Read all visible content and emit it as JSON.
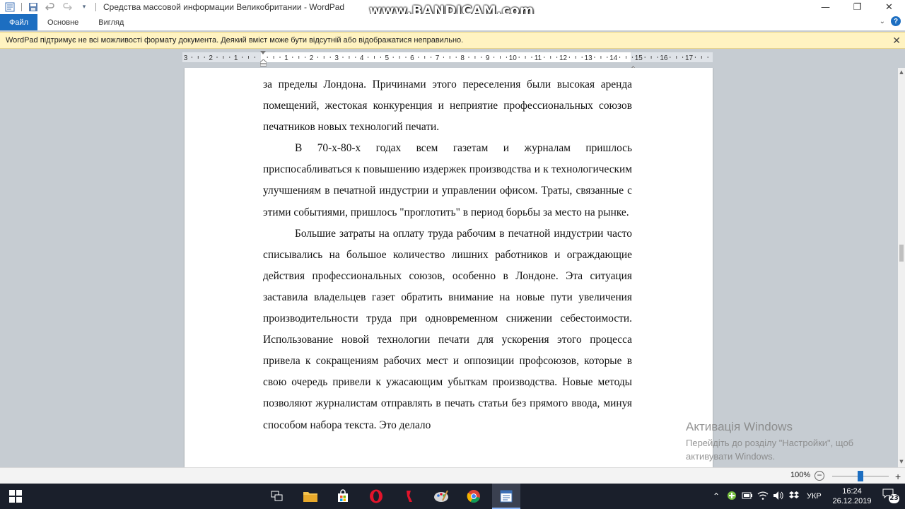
{
  "window": {
    "title": "Средства массовой информации Великобритании - WordPad",
    "watermark": "www.BANDICAM.com",
    "minimize": "—",
    "restore": "❐",
    "close": "✕"
  },
  "ribbon": {
    "tabs": [
      "Файл",
      "Основне",
      "Вигляд"
    ],
    "collapse": "⌄",
    "help": "?"
  },
  "infobar": {
    "message": "WordPad підтримує не всі можливості формату документа. Деякий вміст може бути відсутній або відображатися неправильно.",
    "close": "✕"
  },
  "ruler": {
    "labels": [
      "3",
      "2",
      "1",
      "",
      "1",
      "2",
      "3",
      "4",
      "5",
      "6",
      "7",
      "8",
      "9",
      "10",
      "11",
      "12",
      "13",
      "14",
      "15",
      "16",
      "17"
    ]
  },
  "document": {
    "paragraphs": [
      {
        "indent": false,
        "text": "за пределы Лондона. Причинами этого переселения были высокая аренда помещений, жестокая конкуренция и неприятие профессиональных союзов печатников новых технологий печати."
      },
      {
        "indent": true,
        "text": "В 70-х-80-х годах всем газетам и журналам пришлось приспосабливаться к повышению издержек производства и к технологическим улучшениям в печатной индустрии и управлении офисом. Траты, связанные с этими событиями, пришлось \"проглотить\" в период борьбы за место на рынке."
      },
      {
        "indent": true,
        "text": "Большие затраты на оплату труда рабочим в печатной индустрии часто списывались на большое количество лишних работников и ограждающие действия профессиональных союзов, особенно в Лондоне. Эта ситуация заставила владельцев газет обратить внимание на новые пути увеличения производительности труда при одновременном снижении себестоимости. Использование новой технологии печати для ускорения этого процесса привела к сокращениям рабочих мест и оппозиции профсоюзов, которые в свою очередь привели к ужасающим убыткам производства. Новые методы позволяют журналистам отправлять в печать статьи без прямого ввода, минуя способом набора текста. Это делало"
      }
    ]
  },
  "activation": {
    "title": "Активація Windows",
    "line1": "Перейдіть до розділу \"Настройки\", щоб",
    "line2": "активувати Windows."
  },
  "statusbar": {
    "zoom": "100%",
    "zoom_minus": "−",
    "zoom_plus": "+",
    "zoom_level": 0.5
  },
  "taskbar": {
    "apps": [
      "start-icon",
      "task-view-icon",
      "file-explorer-icon",
      "store-icon",
      "opera-icon",
      "yandex-icon",
      "paint-icon",
      "chrome-icon",
      "wordpad-icon"
    ],
    "language": "УКР",
    "time": "16:24",
    "date": "26.12.2019",
    "notifications": "23"
  },
  "colors": {
    "accent": "#1c6ec1",
    "infobar": "#fff3c1",
    "taskbar": "#1a1f2b",
    "workspace": "#c6ccd2"
  }
}
